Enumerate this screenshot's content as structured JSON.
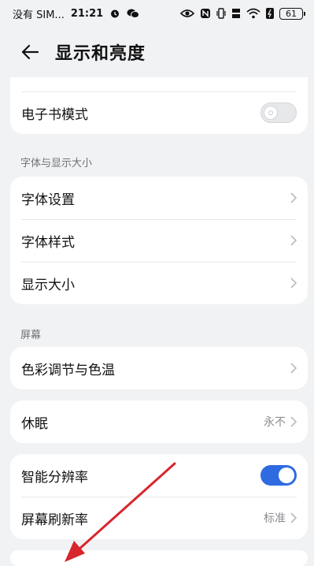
{
  "status_bar": {
    "carrier": "没有 SIM...",
    "time": "21:21",
    "battery": "61"
  },
  "header": {
    "title": "显示和亮度"
  },
  "ebook": {
    "label": "电子书模式",
    "enabled": false
  },
  "font_section": {
    "title": "字体与显示大小",
    "items": [
      {
        "label": "字体设置"
      },
      {
        "label": "字体样式"
      },
      {
        "label": "显示大小"
      }
    ]
  },
  "screen_section": {
    "title": "屏幕",
    "color_item": "色彩调节与色温"
  },
  "sleep": {
    "label": "休眠",
    "value": "永不"
  },
  "resolution": {
    "label": "智能分辨率",
    "enabled": true,
    "refresh_label": "屏幕刷新率",
    "refresh_value": "标准"
  },
  "colors": {
    "accent": "#2f6be0",
    "annotation_arrow": "#d7262c",
    "background": "#f1f2f4"
  }
}
